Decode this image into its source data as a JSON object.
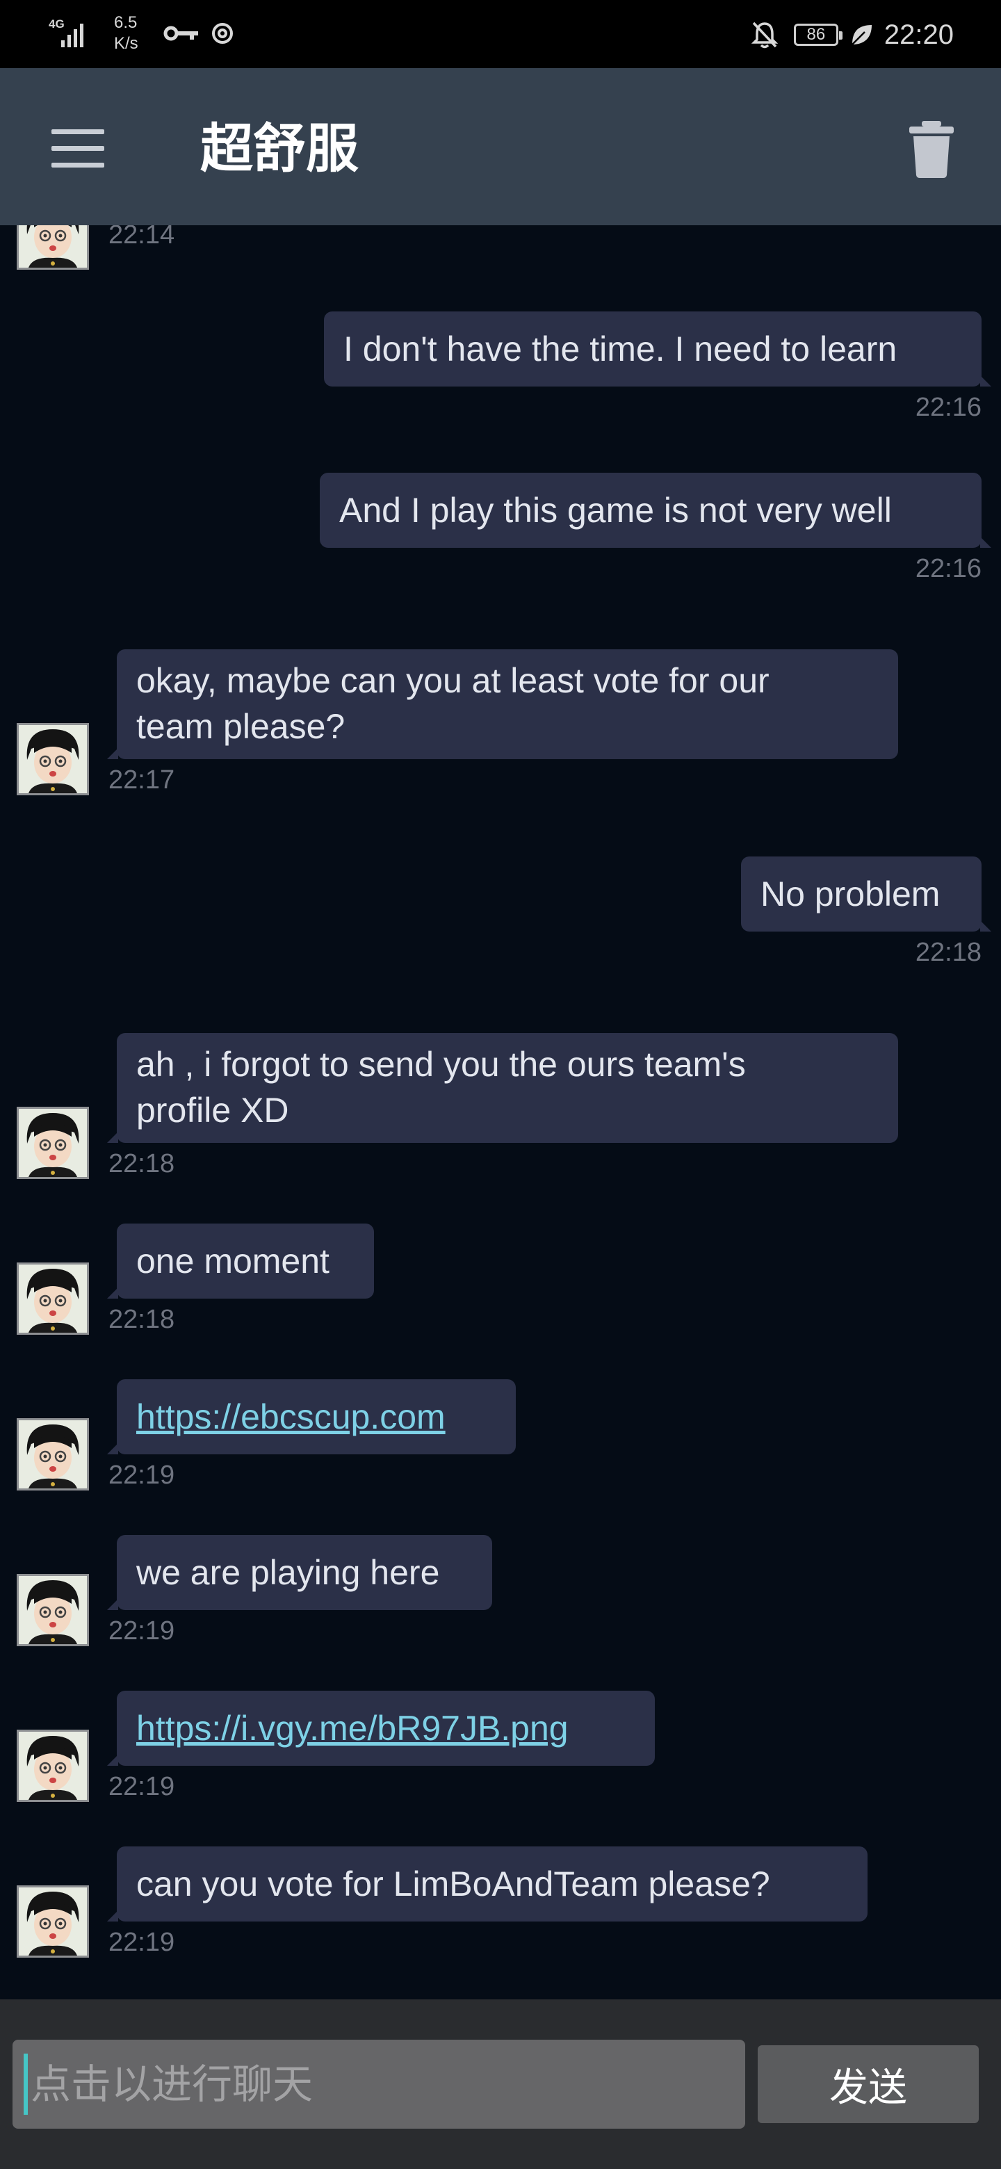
{
  "status_bar": {
    "network": "4G",
    "speed_value": "6.5",
    "speed_unit": "K/s",
    "battery": "86",
    "time": "22:20",
    "icons": [
      "signal-icon",
      "key-icon",
      "sync-icon",
      "bell-off-icon",
      "battery-icon",
      "leaf-icon"
    ]
  },
  "header": {
    "title": "超舒服",
    "menu_icon": "hamburger-menu-icon",
    "delete_icon": "trash-icon",
    "colors": {
      "bar": "#35414f",
      "title": "#ffffff"
    }
  },
  "messages": [
    {
      "direction": "in",
      "text": "",
      "time": "22:14",
      "partial": true
    },
    {
      "direction": "out",
      "text": "I don't have the time. I need to learn",
      "time": "22:16"
    },
    {
      "direction": "out",
      "text": "And I play this game is not very well",
      "time": "22:16"
    },
    {
      "direction": "in",
      "lines": [
        "okay, maybe  can you at least vote for our",
        "team please?"
      ],
      "time": "22:17"
    },
    {
      "direction": "out",
      "text": "No problem",
      "time": "22:18"
    },
    {
      "direction": "in",
      "lines": [
        "ah , i forgot to send you the ours team's",
        "profile XD"
      ],
      "time": "22:18"
    },
    {
      "direction": "in",
      "text": "one moment",
      "time": "22:18"
    },
    {
      "direction": "in",
      "link": "https://ebcscup.com",
      "time": "22:19"
    },
    {
      "direction": "in",
      "text": "we are playing here",
      "time": "22:19"
    },
    {
      "direction": "in",
      "link": "https://i.vgy.me/bR97JB.png",
      "time": "22:19"
    },
    {
      "direction": "in",
      "text": "can you vote for LimBoAndTeam please?",
      "time": "22:19"
    }
  ],
  "colors": {
    "background": "#050c16",
    "bubble": "#2b3048",
    "link": "#7ed1e6",
    "timestamp": "#6f7480"
  },
  "input": {
    "placeholder": "点击以进行聊天",
    "value": ""
  },
  "send_label": "发送"
}
